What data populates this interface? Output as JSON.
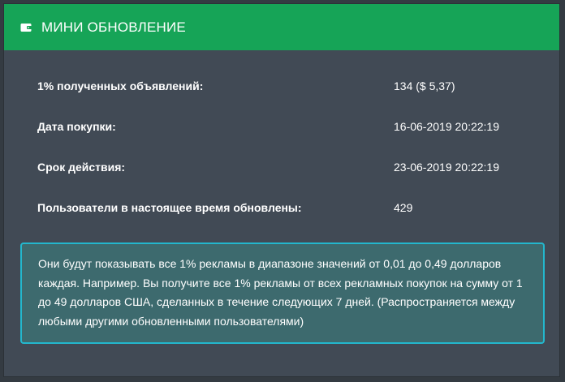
{
  "header": {
    "title": "МИНИ ОБНОВЛЕНИЕ",
    "icon": "wallet-icon",
    "background_color": "#16a457"
  },
  "info": {
    "rows": [
      {
        "label": "1% полученных объявлений:",
        "value": "134 ($ 5,37)"
      },
      {
        "label": "Дата покупки:",
        "value": "16-06-2019 20:22:19"
      },
      {
        "label": "Срок действия:",
        "value": "23-06-2019 20:22:19"
      },
      {
        "label": "Пользователи в настоящее время обновлены:",
        "value": "429"
      }
    ]
  },
  "notice": {
    "text": "Они будут показывать все 1% рекламы в диапазоне значений от 0,01 до 0,49 долларов каждая. Например. Вы получите все 1% рекламы от всех рекламных покупок на сумму от 1 до 49 долларов США, сделанных в течение следующих 7 дней. (Распространяется между любыми другими обновленными пользователями)",
    "border_color": "#23b7cd",
    "background_color": "#3d6a6e"
  }
}
